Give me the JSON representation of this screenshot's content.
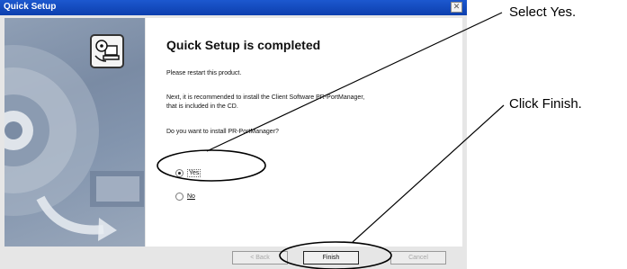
{
  "window": {
    "title": "Quick Setup",
    "close_symbol": "✕"
  },
  "content": {
    "heading": "Quick Setup is completed",
    "line1": "Please restart this product.",
    "line2a": "Next, it is recommended to install the Client Software PR-PortManager,",
    "line2b": "that is included in the CD.",
    "line3": "Do you want to install PR-PortManager?"
  },
  "options": {
    "yes_label": "Yes",
    "no_label": "No",
    "selected": "Yes"
  },
  "buttons": {
    "back_label": "< Back",
    "finish_label": "Finish",
    "cancel_label": "Cancel"
  },
  "callouts": {
    "yes_text": "Select Yes.",
    "finish_text": "Click Finish."
  },
  "colors": {
    "titlebar": "#0d3fae",
    "panel": "#8395ae",
    "dialog_bg": "#e6e6e6"
  },
  "icons": [
    "computer-cd-icon",
    "cd-disc-icon",
    "close-icon"
  ]
}
